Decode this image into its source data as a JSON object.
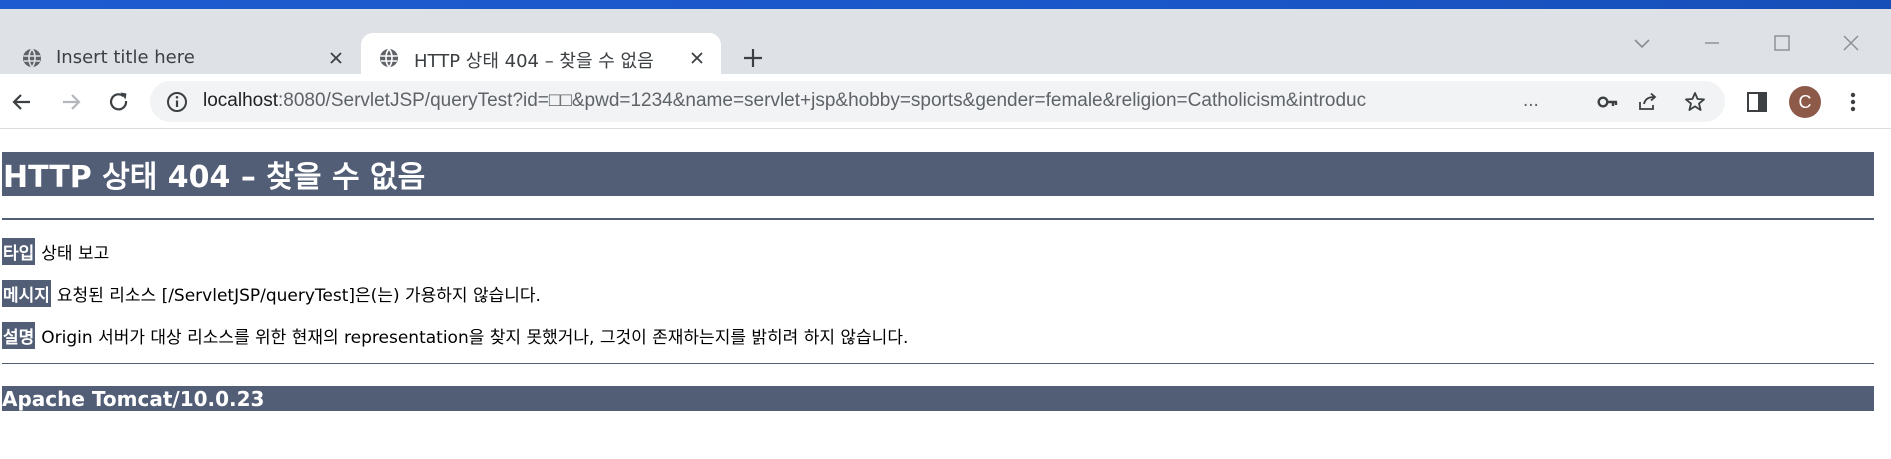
{
  "browser": {
    "tabs": [
      {
        "title": "Insert title here",
        "active": false,
        "icon": "globe-icon"
      },
      {
        "title": "HTTP 상태 404 – 찾을 수 없음",
        "active": true,
        "icon": "globe-icon"
      }
    ],
    "address_bar": {
      "host": "localhost",
      "rest": ":8080/ServletJSP/queryTest?id=□□&pwd=1234&name=servlet+jsp&hobby=sports&gender=female&religion=Catholicism&introduc",
      "ellipsis": "..."
    },
    "profile_initial": "C",
    "colors": {
      "accent": "#1e5bd0",
      "chrome_bg": "#dee1e6",
      "avatar": "#8d5a4a"
    }
  },
  "page": {
    "heading": "HTTP 상태 404 – 찾을 수 없음",
    "type_label": "타입",
    "type_value": "상태 보고",
    "message_label": "메시지",
    "message_value": "요청된 리소스 [/ServletJSP/queryTest]은(는) 가용하지 않습니다.",
    "description_label": "설명",
    "description_value": "Origin 서버가 대상 리소스를 위한 현재의 representation을 찾지 못했거나, 그것이 존재하는지를 밝히려 하지 않습니다.",
    "footer": "Apache Tomcat/10.0.23",
    "colors": {
      "bar": "#525d76"
    }
  }
}
